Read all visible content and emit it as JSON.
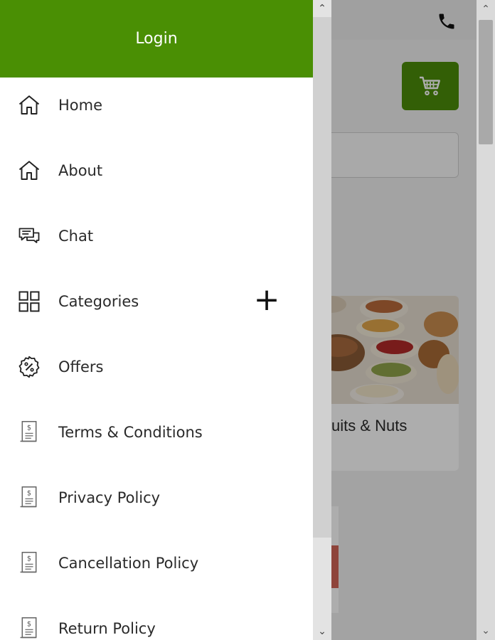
{
  "background": {
    "product_card_title": "uits & Nuts"
  },
  "drawer": {
    "header_label": "Login",
    "items": [
      {
        "label": "Home",
        "icon": "home-icon"
      },
      {
        "label": "About",
        "icon": "home-icon"
      },
      {
        "label": "Chat",
        "icon": "chat-icon"
      },
      {
        "label": "Categories",
        "icon": "grid-icon",
        "expand": "+"
      },
      {
        "label": "Offers",
        "icon": "percent-badge-icon"
      },
      {
        "label": "Terms & Conditions",
        "icon": "document-icon"
      },
      {
        "label": "Privacy Policy",
        "icon": "document-icon"
      },
      {
        "label": "Cancellation Policy",
        "icon": "document-icon"
      },
      {
        "label": "Return Policy",
        "icon": "document-icon"
      }
    ]
  },
  "colors": {
    "brand_green": "#4a8f04",
    "text": "#2a2a2a"
  },
  "scrollbar": {
    "up": "⌃",
    "down": "⌄"
  }
}
